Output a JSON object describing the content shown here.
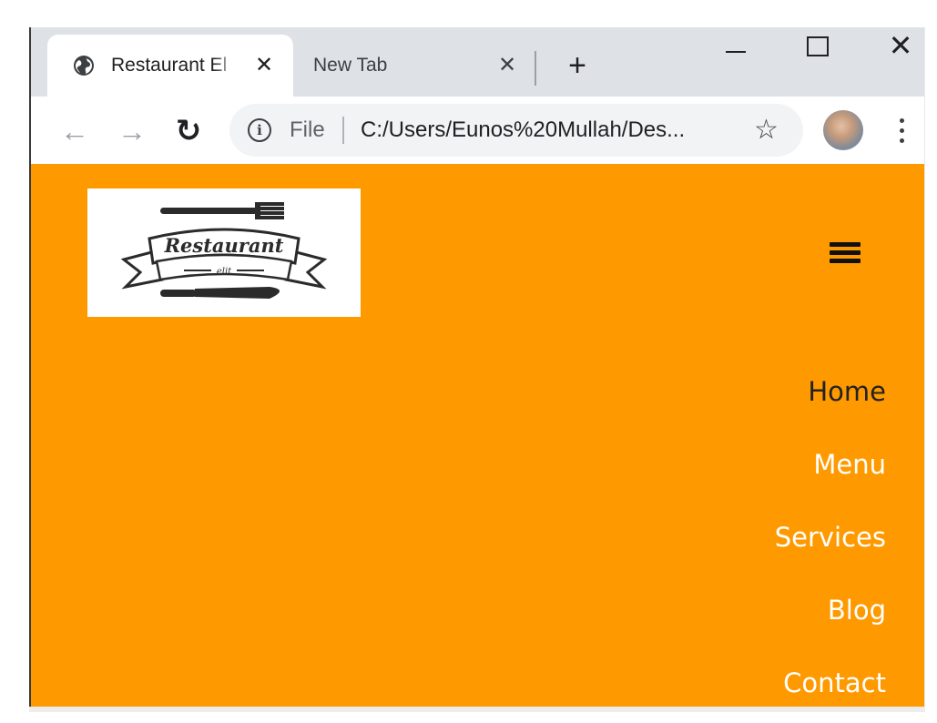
{
  "browser": {
    "tabs": [
      {
        "title": "Restaurant El",
        "active": true
      },
      {
        "title": "New Tab",
        "active": false
      }
    ],
    "new_tab_symbol": "+",
    "close_symbol": "✕",
    "address": {
      "scheme_label": "File",
      "url": "C:/Users/Eunos%20Mullah/Des..."
    },
    "icons": [
      "globe-icon",
      "back-arrow-icon",
      "forward-arrow-icon",
      "reload-icon",
      "info-icon",
      "star-icon",
      "avatar",
      "menu-icon"
    ]
  },
  "site": {
    "logo": {
      "text": "Restaurant",
      "subtext": "elit"
    },
    "nav": [
      {
        "label": "Home",
        "color": "#222222"
      },
      {
        "label": "Menu",
        "color": "#ffffff"
      },
      {
        "label": "Services",
        "color": "#ffffff"
      },
      {
        "label": "Blog",
        "color": "#ffffff"
      },
      {
        "label": "Contact",
        "color": "#ffffff"
      }
    ]
  },
  "colors": {
    "page_background": "#ff9900",
    "tab_strip": "#dee1e6",
    "omnibox": "#f1f3f4"
  }
}
